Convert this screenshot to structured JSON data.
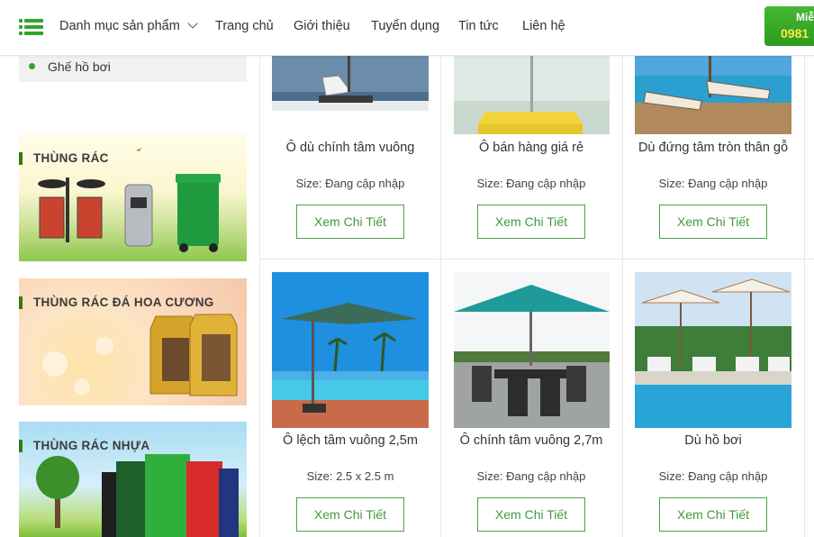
{
  "header": {
    "menu_icon": "hamburger-menu-icon",
    "categories_label": "Danh mục sản phẩm",
    "nav": [
      "Trang chủ",
      "Giới thiệu",
      "Tuyển dụng",
      "Tin tức",
      "Liên hệ"
    ],
    "hotline_top": "Miễ",
    "hotline_phone": "0981",
    "accent": "#2fa52f"
  },
  "sidebar": {
    "list_item": "Ghế hồ bơi",
    "banners": [
      "THÙNG RÁC",
      "THÙNG RÁC ĐÁ HOA CƯƠNG",
      "THÙNG RÁC NHỰA"
    ]
  },
  "products": [
    {
      "name": "Ô dù chính tâm vuông",
      "size": "Size: Đang cập nhập",
      "button": "Xem Chi Tiết"
    },
    {
      "name": "Ô bán hàng giá rẻ",
      "size": "Size: Đang cập nhập",
      "button": "Xem Chi Tiết"
    },
    {
      "name": "Dù đứng tâm tròn thân gỗ",
      "size": "Size: Đang cập nhập",
      "button": "Xem Chi Tiết"
    },
    {
      "name": "Ô lệch tâm vuông 2,5m",
      "size": "Size: 2.5 x 2.5 m",
      "button": "Xem Chi Tiết"
    },
    {
      "name": "Ô chính tâm vuông 2,7m",
      "size": "Size: Đang cập nhập",
      "button": "Xem Chi Tiết"
    },
    {
      "name": "Dù hồ bơi",
      "size": "Size: Đang cập nhập",
      "button": "Xem Chi Tiết"
    }
  ]
}
